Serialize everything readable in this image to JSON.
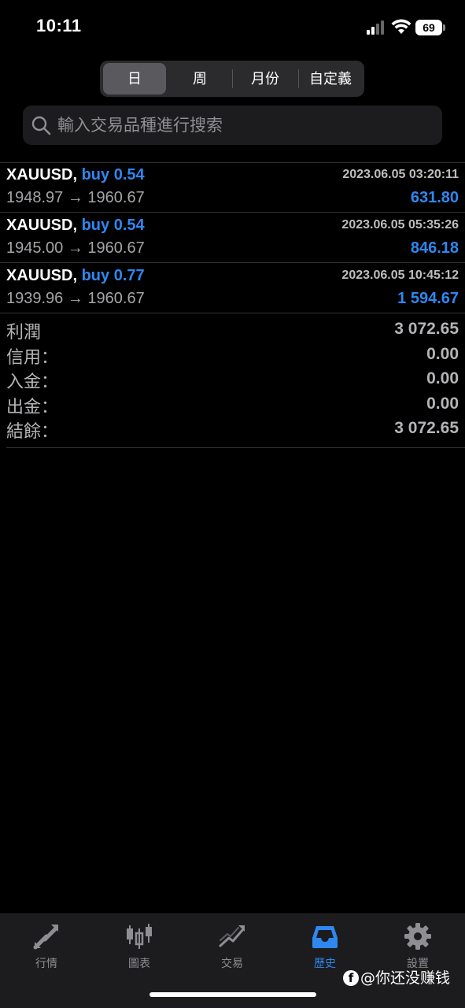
{
  "status_bar": {
    "time": "10:11",
    "battery": "69"
  },
  "period_tabs": [
    "日",
    "周",
    "月份",
    "自定義"
  ],
  "period_active": "日",
  "search": {
    "placeholder": "輸入交易品種進行搜索"
  },
  "deals": [
    {
      "symbol": "XAUUSD,",
      "side": "buy 0.54",
      "datetime": "2023.06.05 03:20:11",
      "open_price": "1948.97",
      "close_price": "1960.67",
      "profit": "631.80"
    },
    {
      "symbol": "XAUUSD,",
      "side": "buy 0.54",
      "datetime": "2023.06.05 05:35:26",
      "open_price": "1945.00",
      "close_price": "1960.67",
      "profit": "846.18"
    },
    {
      "symbol": "XAUUSD,",
      "side": "buy 0.77",
      "datetime": "2023.06.05 10:45:12",
      "open_price": "1939.96",
      "close_price": "1960.67",
      "profit": "1 594.67"
    }
  ],
  "price_arrow": "→",
  "summary": [
    {
      "label": "利潤",
      "value": "3 072.65"
    },
    {
      "label": "信用：",
      "value": "0.00"
    },
    {
      "label": "入金：",
      "value": "0.00"
    },
    {
      "label": "出金：",
      "value": "0.00"
    },
    {
      "label": "結餘：",
      "value": "3 072.65"
    }
  ],
  "tabs": [
    {
      "label": "行情",
      "icon": "quotes-arrows-icon"
    },
    {
      "label": "圖表",
      "icon": "candlestick-chart-icon"
    },
    {
      "label": "交易",
      "icon": "trade-chart-icon"
    },
    {
      "label": "歷史",
      "icon": "history-inbox-icon"
    },
    {
      "label": "設置",
      "icon": "settings-gear-icon"
    }
  ],
  "active_tab": "歷史",
  "watermark": {
    "fb": "f",
    "text": "@你还没赚钱"
  },
  "colors": {
    "accent": "#2f87f0",
    "background": "#000000",
    "secondary_text": "#a4a4a8"
  }
}
